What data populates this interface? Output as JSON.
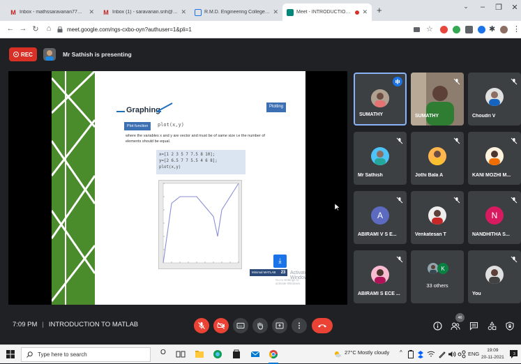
{
  "browser": {
    "tabs": [
      {
        "title": "Inbox - mathssaravanan77@gma",
        "icon": "gmail-icon",
        "color": "#c5221f",
        "active": false
      },
      {
        "title": "Inbox (1) - saravanan.snh@rmd.a",
        "icon": "gmail-icon",
        "color": "#c5221f",
        "active": false
      },
      {
        "title": "R.M.D. Engineering College - Cal",
        "icon": "calendar-icon",
        "color": "#1a73e8",
        "active": false
      },
      {
        "title": "Meet - INTRODUCTION TO",
        "icon": "meet-icon",
        "color": "#00897b",
        "active": true
      }
    ],
    "new_tab": "+",
    "url": "meet.google.com/ngs-cxbo-oyn?authuser=1&pli=1"
  },
  "meet": {
    "rec_label": "REC",
    "presenting_text": "Mr Sathish is presenting",
    "time": "7:09 PM",
    "meeting_title": "INTRODUCTION TO MATLAB",
    "participant_count": "46"
  },
  "slide": {
    "title": "Graphing",
    "plotting_button": "Plotting",
    "plot_function_label": "Plot function",
    "plot_function_code": "plot(x,y)",
    "description": "where the variables x and y are vector and must be of same size i.e the number of elements should be equal.",
    "code_lines": [
      "x=[1 2 3 5 7 7.5 8 10];",
      "y=[2 6.5 7 7 5.5 4 6 8];",
      "plot(x,y)"
    ],
    "minimal_matlab_label": "Minimal MATLAB",
    "page_number": "23",
    "watermark_title": "Activate Windows",
    "watermark_subtitle": "Go to Settings to activate Windows."
  },
  "participants": [
    {
      "name": "SUMATHY",
      "type": "photo",
      "speaking": true
    },
    {
      "name": "SUMATHY",
      "type": "video",
      "speaking": false
    },
    {
      "name": "Choudri V",
      "type": "photo",
      "speaking": false
    },
    {
      "name": "Mr Sathish",
      "type": "photo",
      "speaking": false
    },
    {
      "name": "Jothi Bala A",
      "type": "photo",
      "speaking": false
    },
    {
      "name": "KANI MOZHI M...",
      "type": "photo",
      "speaking": false
    },
    {
      "name": "ABIRAMI V S E...",
      "type": "letter",
      "letter": "A",
      "color": "#5c6bc0",
      "speaking": false
    },
    {
      "name": "Venkatesan T",
      "type": "photo",
      "speaking": false
    },
    {
      "name": "NANDHITHA S...",
      "type": "letter",
      "letter": "N",
      "color": "#d81b60",
      "speaking": false
    },
    {
      "name": "ABIRAMI S ECE ...",
      "type": "photo",
      "speaking": false
    },
    {
      "name": "33 others",
      "type": "others",
      "letter": "K",
      "speaking": false
    },
    {
      "name": "You",
      "type": "photo",
      "speaking": false
    }
  ],
  "taskbar": {
    "search_placeholder": "Type here to search",
    "weather": "27°C  Mostly cloudy",
    "language": "ENG",
    "time": "19:09",
    "date": "20-11-2021"
  }
}
